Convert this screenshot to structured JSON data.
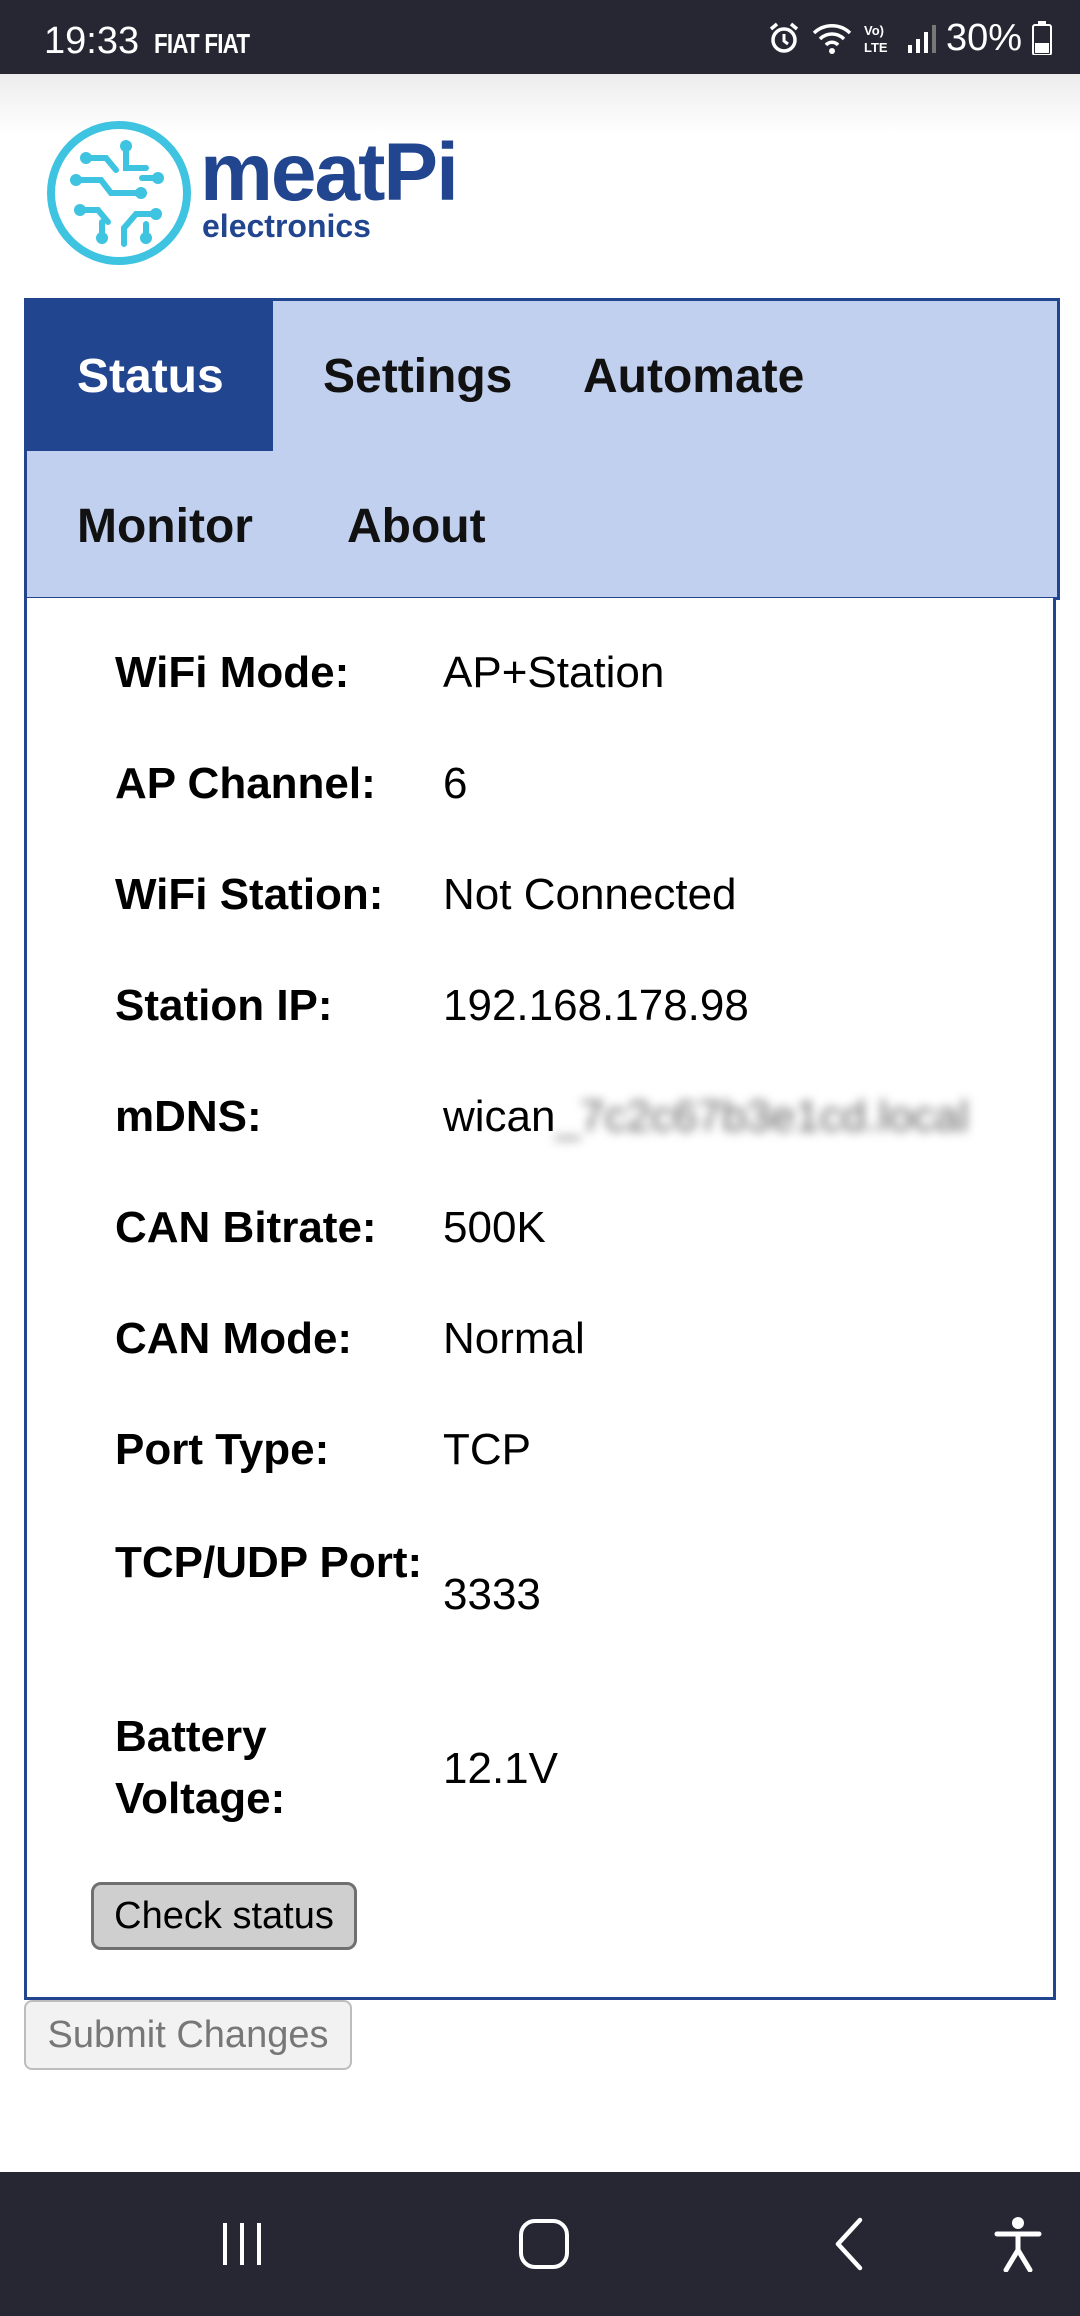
{
  "status_bar": {
    "time": "19:33",
    "carrier": "FIAT FIAT",
    "battery": "30%",
    "icons": [
      "alarm-icon",
      "wifi-icon",
      "volte-icon",
      "signal-icon",
      "battery-icon"
    ]
  },
  "logo": {
    "word": "meatPi",
    "sub": "electronics"
  },
  "tabs": [
    {
      "label": "Status",
      "active": true
    },
    {
      "label": "Settings",
      "active": false
    },
    {
      "label": "Automate",
      "active": false
    },
    {
      "label": "Monitor",
      "active": false
    },
    {
      "label": "About",
      "active": false
    }
  ],
  "status": {
    "rows": [
      {
        "label": "WiFi Mode:",
        "value": "AP+Station"
      },
      {
        "label": "AP Channel:",
        "value": "6"
      },
      {
        "label": "WiFi Station:",
        "value": "Not Connected"
      },
      {
        "label": "Station IP:",
        "value": "192.168.178.98"
      },
      {
        "label": "mDNS:",
        "value": "wican",
        "value_blurred": "_7c2c67b3e1cd.local"
      },
      {
        "label": "CAN Bitrate:",
        "value": "500K"
      },
      {
        "label": "CAN Mode:",
        "value": "Normal"
      },
      {
        "label": "Port Type:",
        "value": "TCP"
      },
      {
        "label": "TCP/UDP Port:",
        "value": "3333"
      },
      {
        "label": "Battery Voltage:",
        "value": "12.1V"
      }
    ],
    "check_button": "Check status"
  },
  "submit_button": "Submit Changes",
  "colors": {
    "accent": "#22458f",
    "tab_background": "#c2d0ef",
    "bars": "#262733"
  },
  "navbar": {
    "icons": [
      "recent-apps-icon",
      "home-icon",
      "back-icon",
      "accessibility-icon"
    ]
  }
}
